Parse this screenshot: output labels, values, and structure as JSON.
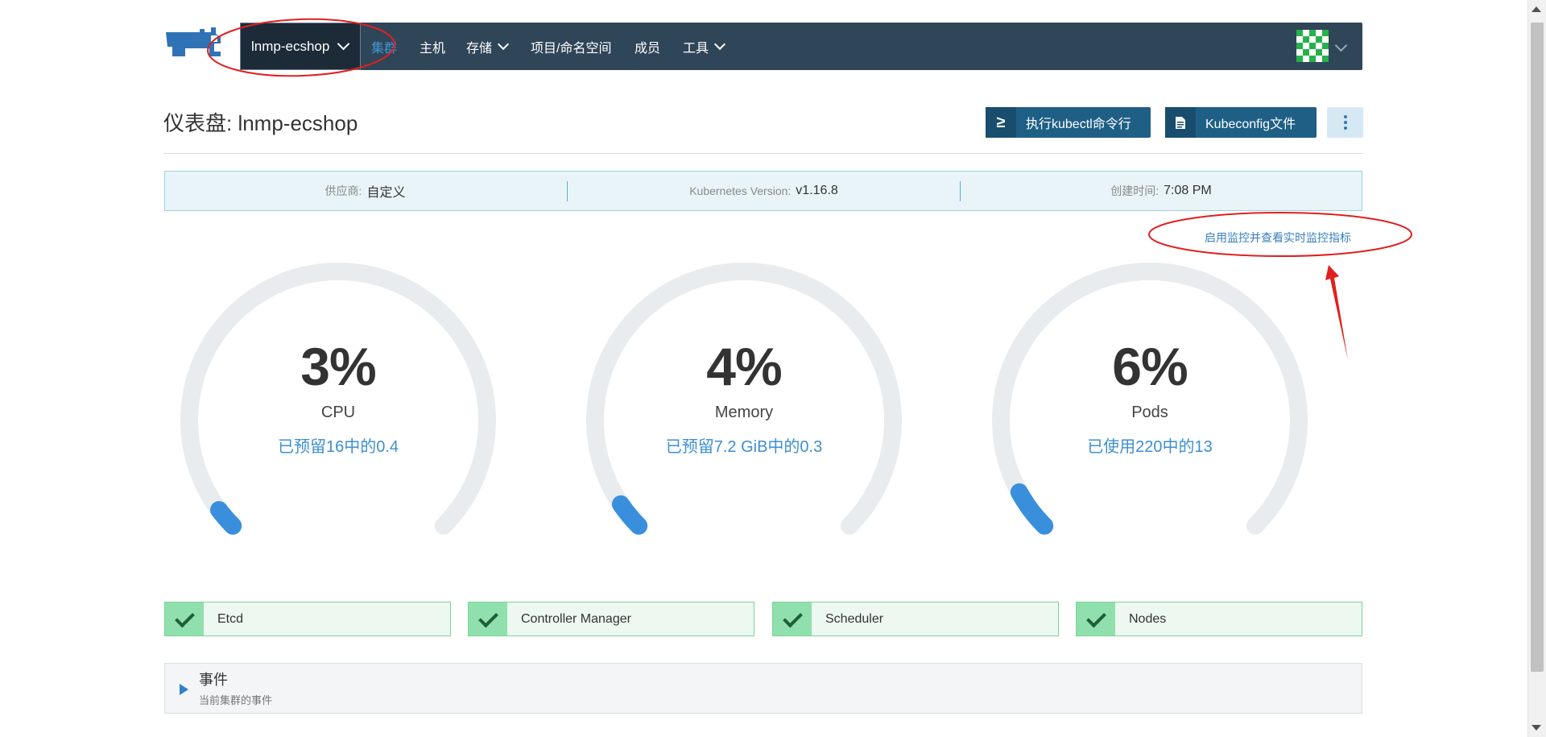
{
  "navbar": {
    "cluster_name": "lnmp-ecshop",
    "items": [
      {
        "label": "集群",
        "active": true,
        "has_dropdown": false
      },
      {
        "label": "主机",
        "active": false,
        "has_dropdown": false
      },
      {
        "label": "存储",
        "active": false,
        "has_dropdown": true
      },
      {
        "label": "项目/命名空间",
        "active": false,
        "has_dropdown": false
      },
      {
        "label": "成员",
        "active": false,
        "has_dropdown": false
      },
      {
        "label": "工具",
        "active": false,
        "has_dropdown": true
      }
    ],
    "icons": [
      "rancher-logo-icon",
      "chevron-down-icon",
      "avatar-icon"
    ]
  },
  "header": {
    "title": "仪表盘: lnmp-ecshop",
    "kubectl_button": "执行kubectl命令行",
    "kubectl_icon": "≥",
    "kubeconfig_button": "Kubeconfig文件",
    "more_icon": "more-vertical-icon"
  },
  "info": {
    "provider_key": "供应商:",
    "provider_value": "自定义",
    "k8s_key": "Kubernetes Version:",
    "k8s_value": "v1.16.8",
    "created_key": "创建时间:",
    "created_value": "7:08 PM"
  },
  "monitoring_link": "启用监控并查看实时监控指标",
  "gauges": [
    {
      "percent": "3%",
      "value": 0.03,
      "label": "CPU",
      "detail": "已预留16中的0.4"
    },
    {
      "percent": "4%",
      "value": 0.04,
      "label": "Memory",
      "detail": "已预留7.2 GiB中的0.3"
    },
    {
      "percent": "6%",
      "value": 0.06,
      "label": "Pods",
      "detail": "已使用220中的13"
    }
  ],
  "components": [
    {
      "name": "Etcd",
      "status": "healthy"
    },
    {
      "name": "Controller Manager",
      "status": "healthy"
    },
    {
      "name": "Scheduler",
      "status": "healthy"
    },
    {
      "name": "Nodes",
      "status": "healthy"
    }
  ],
  "events": {
    "title": "事件",
    "subtitle": "当前集群的事件"
  },
  "colors": {
    "navbar": "#2f4558",
    "accent": "#3d98d3",
    "gauge_track": "#e8ecee",
    "gauge_fill": "#3a8fdc",
    "healthy": "#8fe0ad",
    "annotation": "#e02020"
  }
}
